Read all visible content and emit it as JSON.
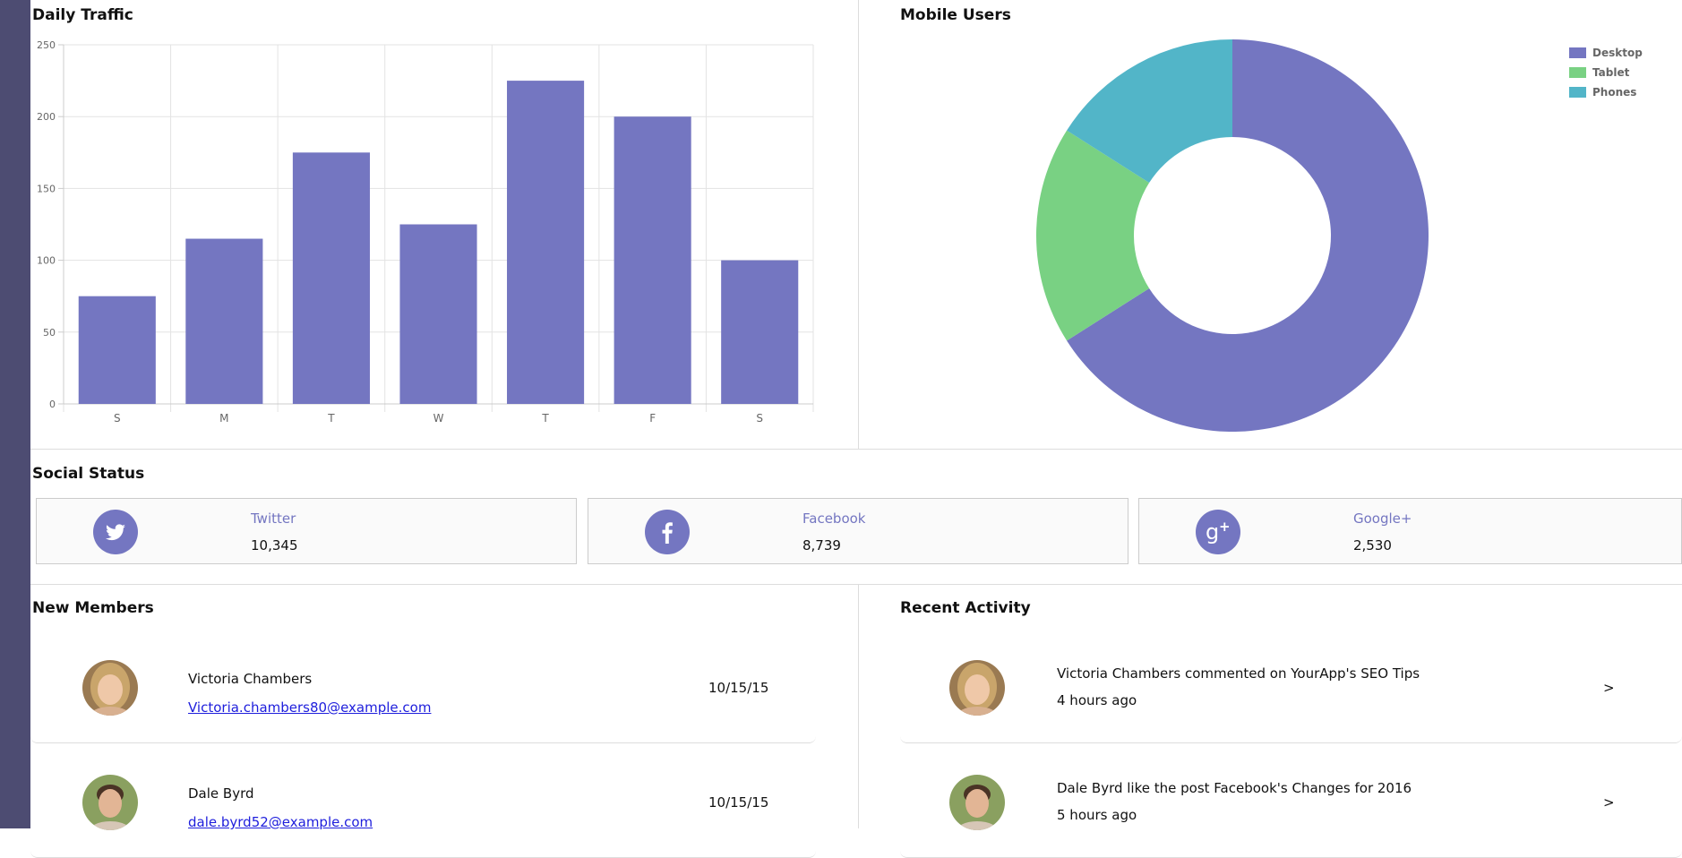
{
  "traffic": {
    "title": "Daily Traffic",
    "chart_data": {
      "type": "bar",
      "categories": [
        "S",
        "M",
        "T",
        "W",
        "T",
        "F",
        "S"
      ],
      "values": [
        75,
        115,
        175,
        125,
        225,
        200,
        100
      ],
      "ylim": [
        0,
        250
      ],
      "yticks": [
        0,
        50,
        100,
        150,
        200,
        250
      ],
      "grid": true,
      "color": "#7476c1"
    }
  },
  "mobile": {
    "title": "Mobile Users",
    "chart_data": {
      "type": "pie",
      "labels": [
        "Desktop",
        "Tablet",
        "Phones"
      ],
      "values": [
        66,
        18,
        16
      ],
      "colors": [
        "#7476c1",
        "#79d183",
        "#52b5c8"
      ],
      "legend": "top-right"
    }
  },
  "social": {
    "title": "Social Status",
    "cards": [
      {
        "name": "Twitter",
        "value": "10,345",
        "icon": "twitter-icon"
      },
      {
        "name": "Facebook",
        "value": "8,739",
        "icon": "facebook-icon"
      },
      {
        "name": "Google+",
        "value": "2,530",
        "icon": "google-plus-icon"
      }
    ]
  },
  "members": {
    "title": "New Members",
    "items": [
      {
        "name": "Victoria Chambers",
        "email": "Victoria.chambers80@example.com",
        "date": "10/15/15"
      },
      {
        "name": "Dale Byrd",
        "email": "dale.byrd52@example.com",
        "date": "10/15/15"
      }
    ]
  },
  "activity": {
    "title": "Recent Activity",
    "items": [
      {
        "text": "Victoria Chambers commented on YourApp's SEO Tips",
        "time": "4 hours ago",
        "arrow": ">"
      },
      {
        "text": "Dale Byrd like the post Facebook's Changes for 2016",
        "time": "5 hours ago",
        "arrow": ">"
      }
    ]
  }
}
